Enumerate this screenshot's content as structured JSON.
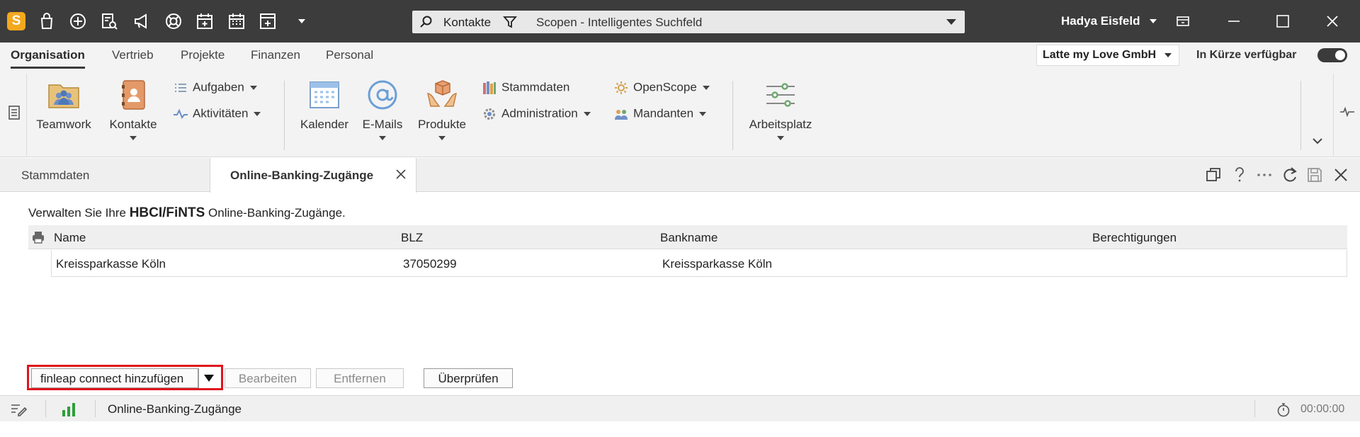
{
  "titlebar": {
    "app_logo": "S",
    "search": {
      "scope": "Kontakte",
      "placeholder": "Scopen - Intelligentes Suchfeld"
    },
    "user": "Hadya Eisfeld"
  },
  "ribbon_tabs": [
    "Organisation",
    "Vertrieb",
    "Projekte",
    "Finanzen",
    "Personal"
  ],
  "company": "Latte my Love GmbH",
  "availability_label": "In Kürze verfügbar",
  "ribbon": {
    "teamwork": "Teamwork",
    "kontakte": "Kontakte",
    "aufgaben": "Aufgaben",
    "aktivitaeten": "Aktivitäten",
    "kalender": "Kalender",
    "emails": "E-Mails",
    "produkte": "Produkte",
    "stammdaten": "Stammdaten",
    "administration": "Administration",
    "openscope": "OpenScope",
    "mandanten": "Mandanten",
    "arbeitsplatz": "Arbeitsplatz"
  },
  "doc_tabs": [
    "Stammdaten",
    "Online-Banking-Zugänge"
  ],
  "content": {
    "intro_pre": "Verwalten Sie Ihre ",
    "intro_bold": "HBCI/FiNTS",
    "intro_post": " Online-Banking-Zugänge.",
    "columns": [
      "Name",
      "BLZ",
      "Bankname",
      "Berechtigungen"
    ],
    "rows": [
      {
        "name": "Kreissparkasse Köln",
        "blz": "37050299",
        "bankname": "Kreissparkasse Köln",
        "berechtigungen": ""
      }
    ]
  },
  "actions": {
    "add": "finleap connect hinzufügen",
    "edit": "Bearbeiten",
    "remove": "Entfernen",
    "check": "Überprüfen"
  },
  "statusbar": {
    "text": "Online-Banking-Zugänge",
    "timer": "00:00:00"
  },
  "colors": {
    "titlebar": "#3c3c3c",
    "logo": "#f4a81d",
    "highlight": "#e0141e",
    "signal": "#2e9e3a"
  }
}
